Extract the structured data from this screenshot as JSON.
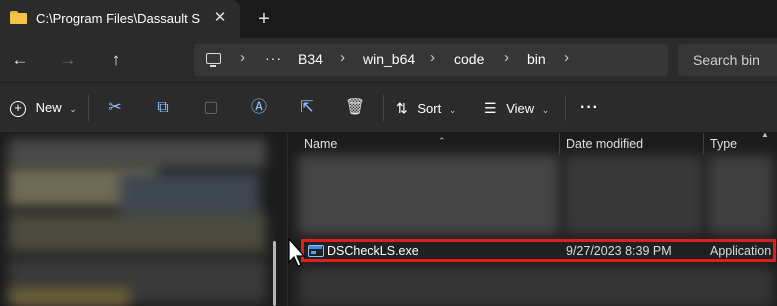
{
  "window": {
    "tab_title": "C:\\Program Files\\Dassault Syst",
    "tab_close": "✕",
    "new_tab": "+"
  },
  "nav": {
    "back": "←",
    "forward": "→",
    "up": "↑",
    "more": "···",
    "breadcrumb": [
      "B34",
      "win_b64",
      "code",
      "bin"
    ],
    "separator": "›",
    "search_placeholder": "Search bin"
  },
  "commands": {
    "new_label": "New",
    "sort_label": "Sort",
    "view_label": "View",
    "more": "···",
    "chevron": "⌄"
  },
  "columns": {
    "name": "Name",
    "date_modified": "Date modified",
    "type": "Type"
  },
  "files": [
    {
      "name": "DSCheckLS.exe",
      "date_modified": "9/27/2023 8:39 PM",
      "type": "Application",
      "highlighted": true
    }
  ],
  "colors": {
    "accent": "#8fc3ff",
    "highlight_border": "#e11d1d",
    "folder": "#f3c348"
  }
}
